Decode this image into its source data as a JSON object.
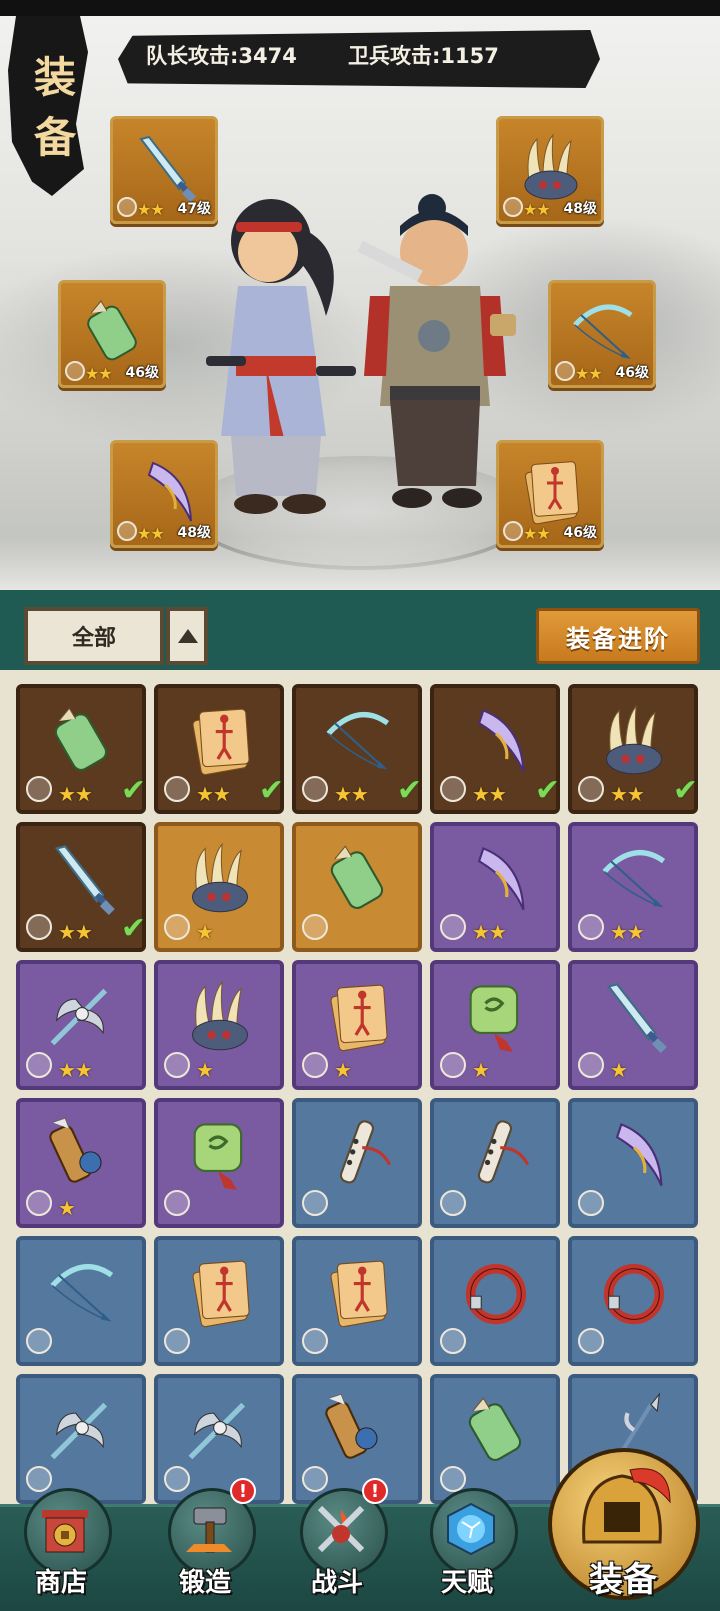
{
  "page": {
    "title_chars": [
      "装",
      "备"
    ]
  },
  "attack": {
    "captain": "队长攻击:3474",
    "guard": "卫兵攻击:1157"
  },
  "equipped_slots": [
    {
      "icon": "sword-icon",
      "stars": "★★",
      "level": "47级"
    },
    {
      "icon": "claw-icon",
      "stars": "★★",
      "level": "48级"
    },
    {
      "icon": "bracer-icon",
      "stars": "★★",
      "level": "46级"
    },
    {
      "icon": "bow-icon",
      "stars": "★★",
      "level": "46级"
    },
    {
      "icon": "blade-icon",
      "stars": "★★",
      "level": "48级"
    },
    {
      "icon": "scroll-icon",
      "stars": "★★",
      "level": "46级"
    }
  ],
  "filter": {
    "selected": "全部"
  },
  "advance_button": "装备进阶",
  "inventory": [
    {
      "icon": "bracer-icon",
      "rarity": "brown",
      "stars": "★★",
      "equipped": true
    },
    {
      "icon": "scroll-icon",
      "rarity": "brown",
      "stars": "★★",
      "equipped": true
    },
    {
      "icon": "bow-icon",
      "rarity": "brown",
      "stars": "★★",
      "equipped": true
    },
    {
      "icon": "blade-icon",
      "rarity": "brown",
      "stars": "★★",
      "equipped": true
    },
    {
      "icon": "claw-icon",
      "rarity": "brown",
      "stars": "★★",
      "equipped": true
    },
    {
      "icon": "sword-icon",
      "rarity": "brown",
      "stars": "★★",
      "equipped": true
    },
    {
      "icon": "claw-icon",
      "rarity": "orange",
      "stars": "★",
      "equipped": false
    },
    {
      "icon": "bracer-icon",
      "rarity": "orange",
      "stars": "",
      "equipped": false
    },
    {
      "icon": "blade-icon",
      "rarity": "purple",
      "stars": "★★",
      "equipped": false
    },
    {
      "icon": "bow-icon",
      "rarity": "purple",
      "stars": "★★",
      "equipped": false
    },
    {
      "icon": "axe-icon",
      "rarity": "purple",
      "stars": "★★",
      "equipped": false
    },
    {
      "icon": "claw-icon",
      "rarity": "purple",
      "stars": "★",
      "equipped": false
    },
    {
      "icon": "scroll-icon",
      "rarity": "purple",
      "stars": "★",
      "equipped": false
    },
    {
      "icon": "jade-amulet-icon",
      "rarity": "purple",
      "stars": "★",
      "equipped": false
    },
    {
      "icon": "sword-icon",
      "rarity": "purple",
      "stars": "★",
      "equipped": false
    },
    {
      "icon": "cannon-icon",
      "rarity": "purple",
      "stars": "★",
      "equipped": false
    },
    {
      "icon": "jade-amulet-icon",
      "rarity": "purple",
      "stars": "",
      "equipped": false
    },
    {
      "icon": "flute-icon",
      "rarity": "blue",
      "stars": "",
      "equipped": false
    },
    {
      "icon": "flute-icon",
      "rarity": "blue",
      "stars": "",
      "equipped": false
    },
    {
      "icon": "blade-icon",
      "rarity": "blue",
      "stars": "",
      "equipped": false
    },
    {
      "icon": "bow-icon",
      "rarity": "blue",
      "stars": "",
      "equipped": false
    },
    {
      "icon": "scroll-icon",
      "rarity": "blue",
      "stars": "",
      "equipped": false
    },
    {
      "icon": "scroll-icon",
      "rarity": "blue",
      "stars": "",
      "equipped": false
    },
    {
      "icon": "ring-icon",
      "rarity": "blue",
      "stars": "",
      "equipped": false
    },
    {
      "icon": "ring-icon",
      "rarity": "blue",
      "stars": "",
      "equipped": false
    },
    {
      "icon": "axe-icon",
      "rarity": "blue",
      "stars": "",
      "equipped": false
    },
    {
      "icon": "axe-icon",
      "rarity": "blue",
      "stars": "",
      "equipped": false
    },
    {
      "icon": "cannon-icon",
      "rarity": "blue",
      "stars": "",
      "equipped": false
    },
    {
      "icon": "bracer-icon",
      "rarity": "blue",
      "stars": "",
      "equipped": false
    },
    {
      "icon": "spear-icon",
      "rarity": "blue",
      "stars": "",
      "equipped": false
    }
  ],
  "nav": {
    "shop": "商店",
    "forge": "锻造",
    "battle": "战斗",
    "talent": "天赋",
    "equipment": "装备",
    "alert": "!"
  },
  "colors": {
    "brown": "#5b3a20",
    "orange": "#c98a34",
    "purple": "#7a5aa1",
    "blue": "#55789f",
    "star": "#f6c533",
    "check": "#7ed957",
    "teal": "#1f5b53"
  }
}
